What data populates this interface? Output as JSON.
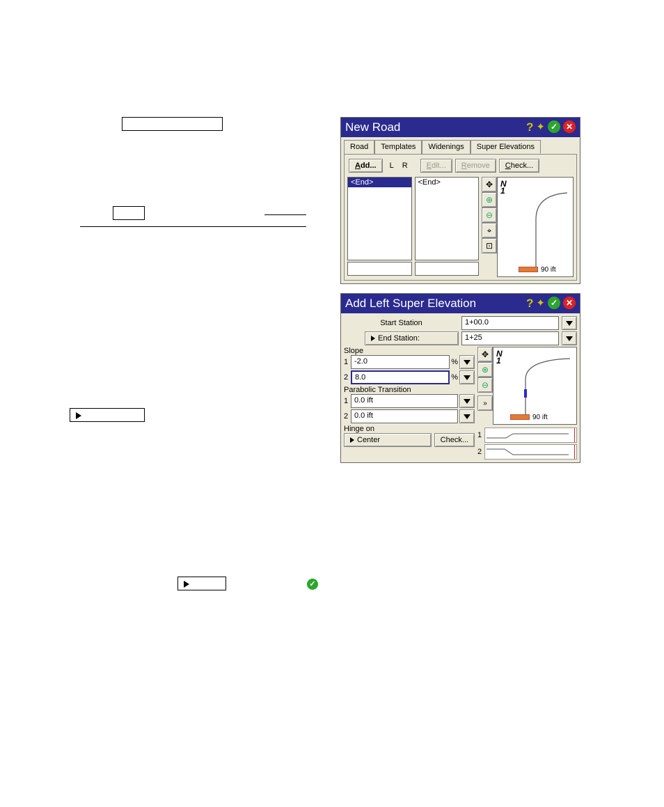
{
  "buttons_left": {
    "b1_width": 145,
    "b2_label": "",
    "b2_width": 46,
    "b3_width": 108,
    "b4_width": 70
  },
  "window1": {
    "title": "New Road",
    "tabs": [
      "Road",
      "Templates",
      "Widenings",
      "Super Elevations"
    ],
    "active_tab": 3,
    "toolbar": {
      "add": "Add...",
      "lr": [
        "L",
        "R"
      ],
      "edit": "Edit...",
      "remove": "Remove",
      "check": "Check..."
    },
    "left_list": {
      "items": [
        "<End>"
      ],
      "selected": 0
    },
    "right_list": {
      "items": [
        "<End>"
      ]
    },
    "scale_label": "90 ift"
  },
  "window2": {
    "title": "Add Left Super Elevation",
    "start_station_label": "Start Station",
    "start_station_value": "1+00.0",
    "end_station_btn": "End Station:",
    "end_station_value": "1+25",
    "slope_label": "Slope",
    "slope_rows": [
      {
        "n": "1",
        "val": "-2.0",
        "unit": "%"
      },
      {
        "n": "2",
        "val": "8.0",
        "unit": "%"
      }
    ],
    "parabolic_label": "Parabolic Transition",
    "parabolic_rows": [
      {
        "n": "1",
        "val": "0.0 ift"
      },
      {
        "n": "2",
        "val": "0.0 ift"
      }
    ],
    "hinge_label": "Hinge on",
    "hinge_btn": "Center",
    "check_btn": "Check...",
    "scale_label": "90 ift",
    "mini_labels": [
      "1",
      "2"
    ]
  }
}
